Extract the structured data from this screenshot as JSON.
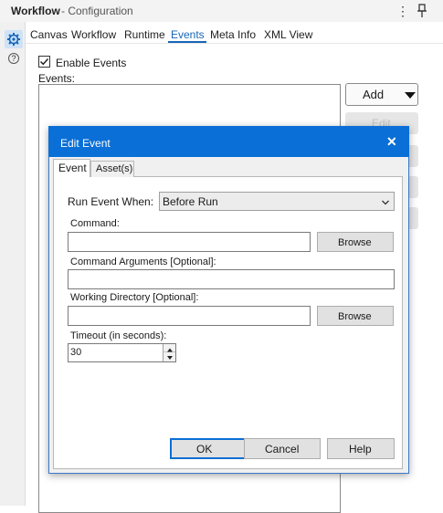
{
  "panel": {
    "title": "Workflow",
    "subtitle": "- Configuration",
    "menu_glyph": "⋮"
  },
  "rail": {
    "items": [
      {
        "icon": "gear-icon",
        "selected": true
      },
      {
        "icon": "help-icon",
        "glyph": "?"
      }
    ]
  },
  "tabs": [
    "Canvas",
    "Workflow",
    "Runtime",
    "Events",
    "Meta Info",
    "XML View"
  ],
  "active_tab": "Events",
  "events_page": {
    "enable_events_label": "Enable Events",
    "enable_events_checked": true,
    "events_label": "Events:",
    "add_label": "Add",
    "edit_label": "Edit"
  },
  "dialog": {
    "title": "Edit Event",
    "close_glyph": "✕",
    "tabs": [
      "Event",
      "Asset(s)"
    ],
    "active_tab": "Event",
    "run_event_when_label": "Run Event When:",
    "run_event_when_value": "Before Run",
    "command_label": "Command:",
    "command_value": "",
    "command_args_label": "Command Arguments [Optional]:",
    "command_args_value": "",
    "working_dir_label": "Working Directory [Optional]:",
    "working_dir_value": "",
    "browse_label": "Browse",
    "timeout_label": "Timeout (in seconds):",
    "timeout_value": "30",
    "ok_label": "OK",
    "cancel_label": "Cancel",
    "help_label": "Help"
  },
  "colors": {
    "accent": "#1666b8",
    "dialog_titlebar": "#0a6fd6"
  }
}
